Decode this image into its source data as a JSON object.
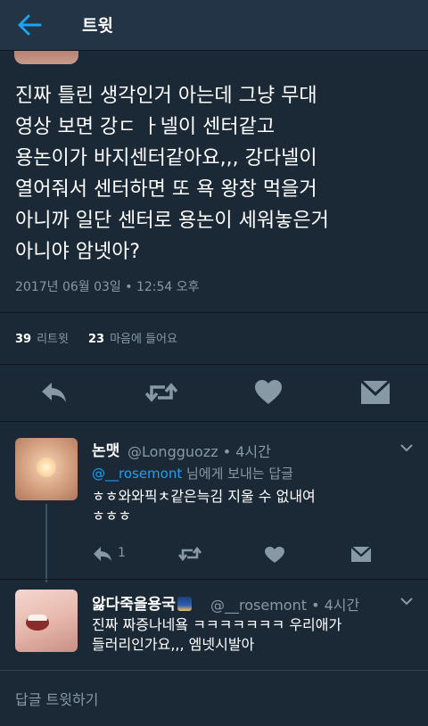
{
  "header": {
    "title": "트윗"
  },
  "tweet": {
    "text": "진짜 틀린 생각인거 아는데 그냥 무대\n영상 보면 강ㄷ ㅏ넬이 센터같고\n용논이가 바지센터같아요,,, 강다넬이\n열어줘서 센터하면 또 욕 왕창 먹을거\n아니까 일단 센터로 용논이 세워놓은거\n아니야 암넷아?",
    "timestamp": "2017년 06월 03일 • 12:54 오후",
    "retweets_count": "39",
    "retweets_label": "리트윗",
    "likes_count": "23",
    "likes_label": "마음에 들어요"
  },
  "replies": [
    {
      "name": "논맷",
      "handle": "@Longguozz • 4시간",
      "replying_to_mention": "@__rosemont",
      "replying_to_suffix": " 님에게 보내는 답글",
      "text": "ㅎㅎ와와픽ㅊ같은늑김 지울 수 없내여\nㅎㅎㅎ",
      "reply_count": "1"
    },
    {
      "name": "앓다죽을용국",
      "handle": "@__rosemont • 4시간",
      "text": "진짜 짜증나네욬 ㅋㅋㅋㅋㅋㅋㅋ 우리애가\n들러리인가요,,, 엠넷시발아"
    }
  ],
  "compose": {
    "placeholder": "답글 트윗하기"
  },
  "colors": {
    "background": "#1b2836",
    "accent": "#1da1f2",
    "muted": "#8899a6"
  }
}
